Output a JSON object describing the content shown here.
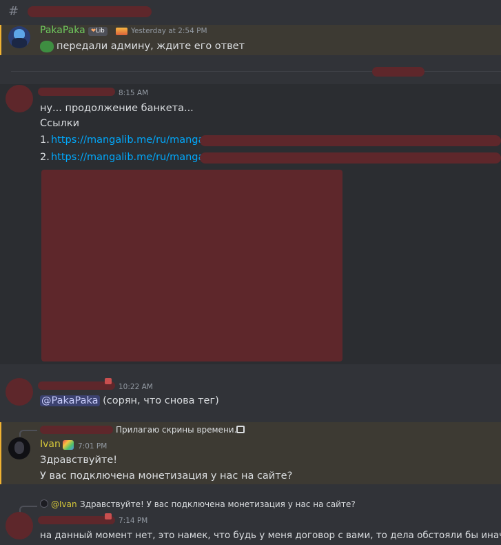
{
  "channel": {
    "hash": "#"
  },
  "messages": {
    "m1": {
      "author": "PakaPaka",
      "badge": "Lib",
      "time": "Yesterday at 2:54 PM",
      "text": "передали админу, ждите его ответ"
    },
    "m2": {
      "time": "8:15 AM",
      "line1": "ну... продолжение банкета...",
      "line2": "Ссылки",
      "link1_num": "1.",
      "link1": "https://mangalib.me/ru/manga/",
      "link2_num": "2.",
      "link2": "https://mangalib.me/ru/manga/"
    },
    "m3": {
      "time": "10:22 AM",
      "mention": "@PakaPaka",
      "text": "(сорян, что снова тег)"
    },
    "m4": {
      "reply_text": "Прилагаю скрины времени.",
      "author": "Ivan",
      "time": "7:01 PM",
      "line1": "Здравствуйте!",
      "line2": "У вас подключена монетизация у нас на сайте?"
    },
    "m5": {
      "reply_author": "@Ivan",
      "reply_text": "Здравствуйте! У вас подключена монетизация у нас на сайте?",
      "time": "7:14 PM",
      "text": "на данный момент нет, это намек, что будь у меня договор с вами, то дела обстояли бы иначе?"
    }
  },
  "colors": {
    "background": "#313338",
    "highlight": "#2b2d31",
    "mention_row": "#3d3a33",
    "mention_bar": "#f0b232",
    "redaction": "#5e272b",
    "link": "#00a8fc",
    "pakapaka_name": "#6fc95e",
    "ivan_name": "#d7c93a"
  }
}
